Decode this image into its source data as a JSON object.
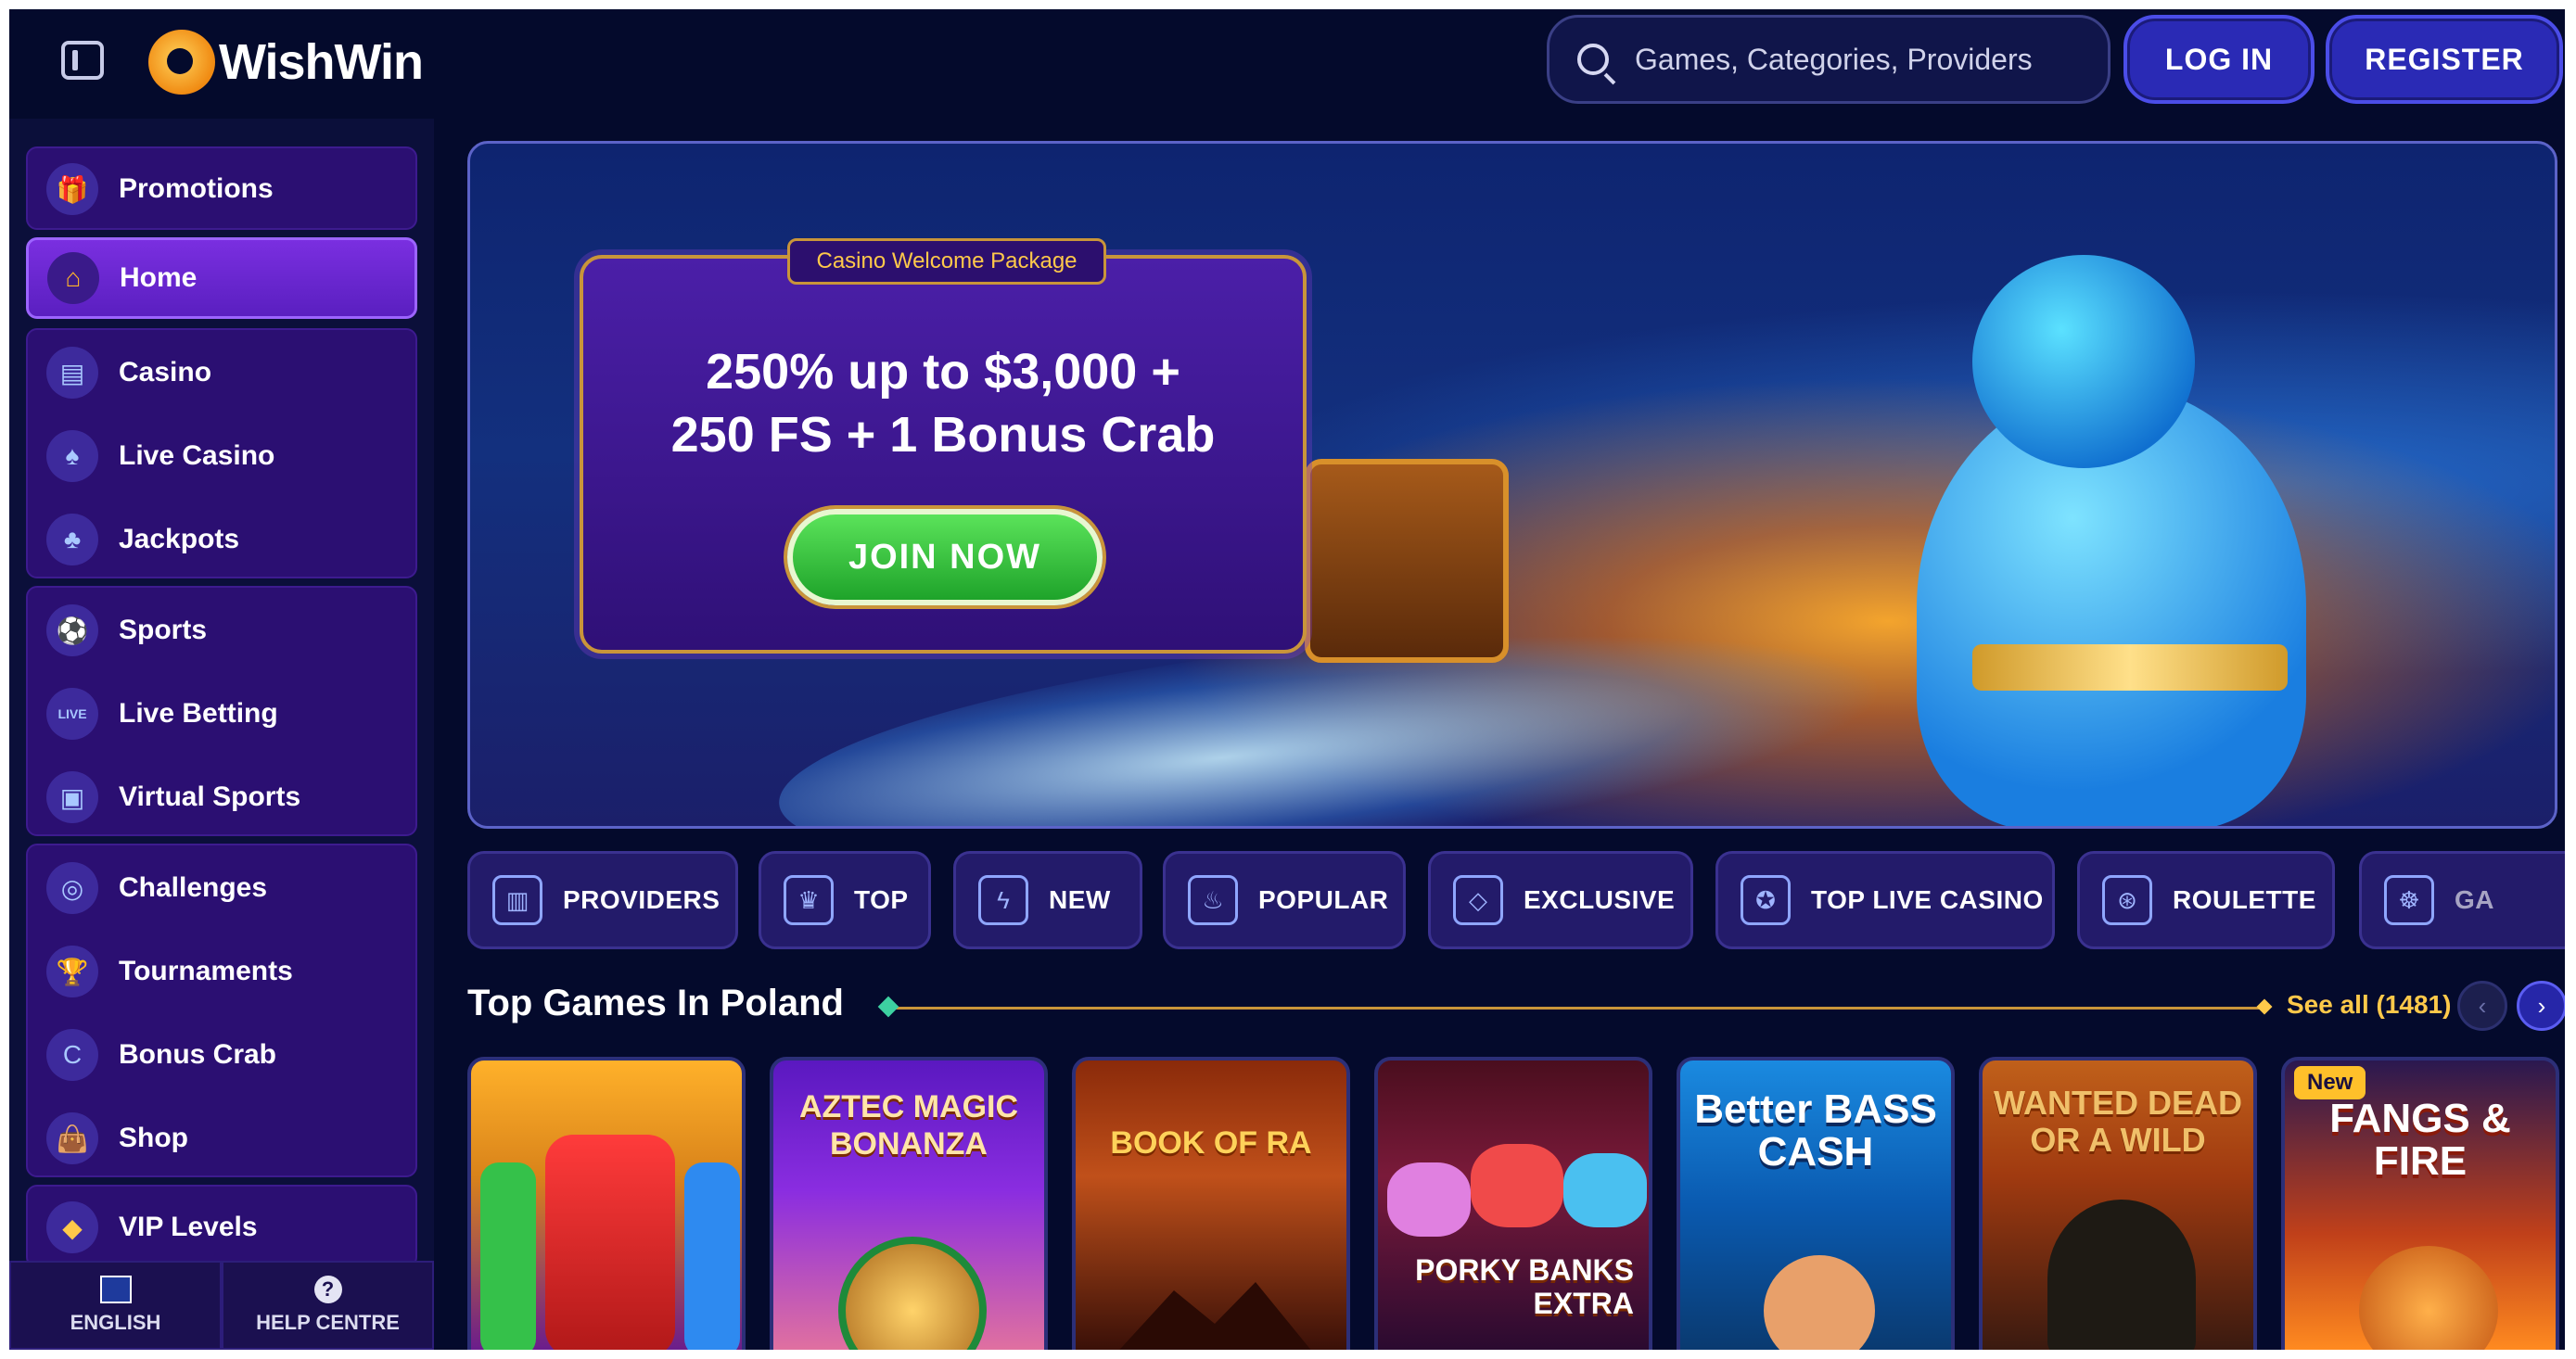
{
  "header": {
    "logo_text": "WishWin",
    "search_placeholder": "Games, Categories, Providers",
    "login_label": "LOG IN",
    "register_label": "REGISTER"
  },
  "sidebar": {
    "items": [
      {
        "label": "Promotions",
        "icon": "gift-icon",
        "active": false
      },
      {
        "label": "Home",
        "icon": "home-icon",
        "active": true
      },
      {
        "label": "Casino",
        "icon": "slot-machine-icon",
        "active": false
      },
      {
        "label": "Live Casino",
        "icon": "playing-card-icon",
        "active": false
      },
      {
        "label": "Jackpots",
        "icon": "clover-icon",
        "active": false
      },
      {
        "label": "Sports",
        "icon": "ball-icon",
        "active": false
      },
      {
        "label": "Live Betting",
        "icon": "live-icon",
        "active": false
      },
      {
        "label": "Virtual Sports",
        "icon": "virtual-icon",
        "active": false
      },
      {
        "label": "Challenges",
        "icon": "target-icon",
        "active": false
      },
      {
        "label": "Tournaments",
        "icon": "trophy-icon",
        "active": false
      },
      {
        "label": "Bonus Crab",
        "icon": "crab-icon",
        "active": false
      },
      {
        "label": "Shop",
        "icon": "shopping-bag-icon",
        "active": false
      },
      {
        "label": "VIP Levels",
        "icon": "diamond-icon",
        "active": false
      }
    ],
    "footer": {
      "language_label": "ENGLISH",
      "help_label": "HELP CENTRE"
    }
  },
  "banner": {
    "tag": "Casino Welcome Package",
    "title_line1": "250% up to $3,000 +",
    "title_line2": "250 FS + 1 Bonus Crab",
    "cta_label": "JOIN NOW"
  },
  "categories": [
    {
      "label": "PROVIDERS",
      "icon": "scroll-icon"
    },
    {
      "label": "TOP",
      "icon": "crown-icon"
    },
    {
      "label": "NEW",
      "icon": "lightning-icon"
    },
    {
      "label": "POPULAR",
      "icon": "flame-icon"
    },
    {
      "label": "EXCLUSIVE",
      "icon": "gem-icon"
    },
    {
      "label": "TOP LIVE CASINO",
      "icon": "badge-icon"
    },
    {
      "label": "ROULETTE",
      "icon": "roulette-icon"
    },
    {
      "label": "GA",
      "icon": "wheel-icon"
    }
  ],
  "section": {
    "title": "Top Games In Poland",
    "see_all_label": "See all (1481)"
  },
  "games": [
    {
      "title": "",
      "new": false
    },
    {
      "title": "AZTEC MAGIC BONANZA",
      "new": false
    },
    {
      "title": "BOOK OF RA",
      "new": false
    },
    {
      "title": "PORKY BANKS EXTRA",
      "new": false
    },
    {
      "title": "Better BASS CASH",
      "new": false
    },
    {
      "title": "WANTED DEAD OR A WILD",
      "new": false
    },
    {
      "title": "FANGS & FIRE",
      "new": true,
      "badge": "New"
    }
  ]
}
